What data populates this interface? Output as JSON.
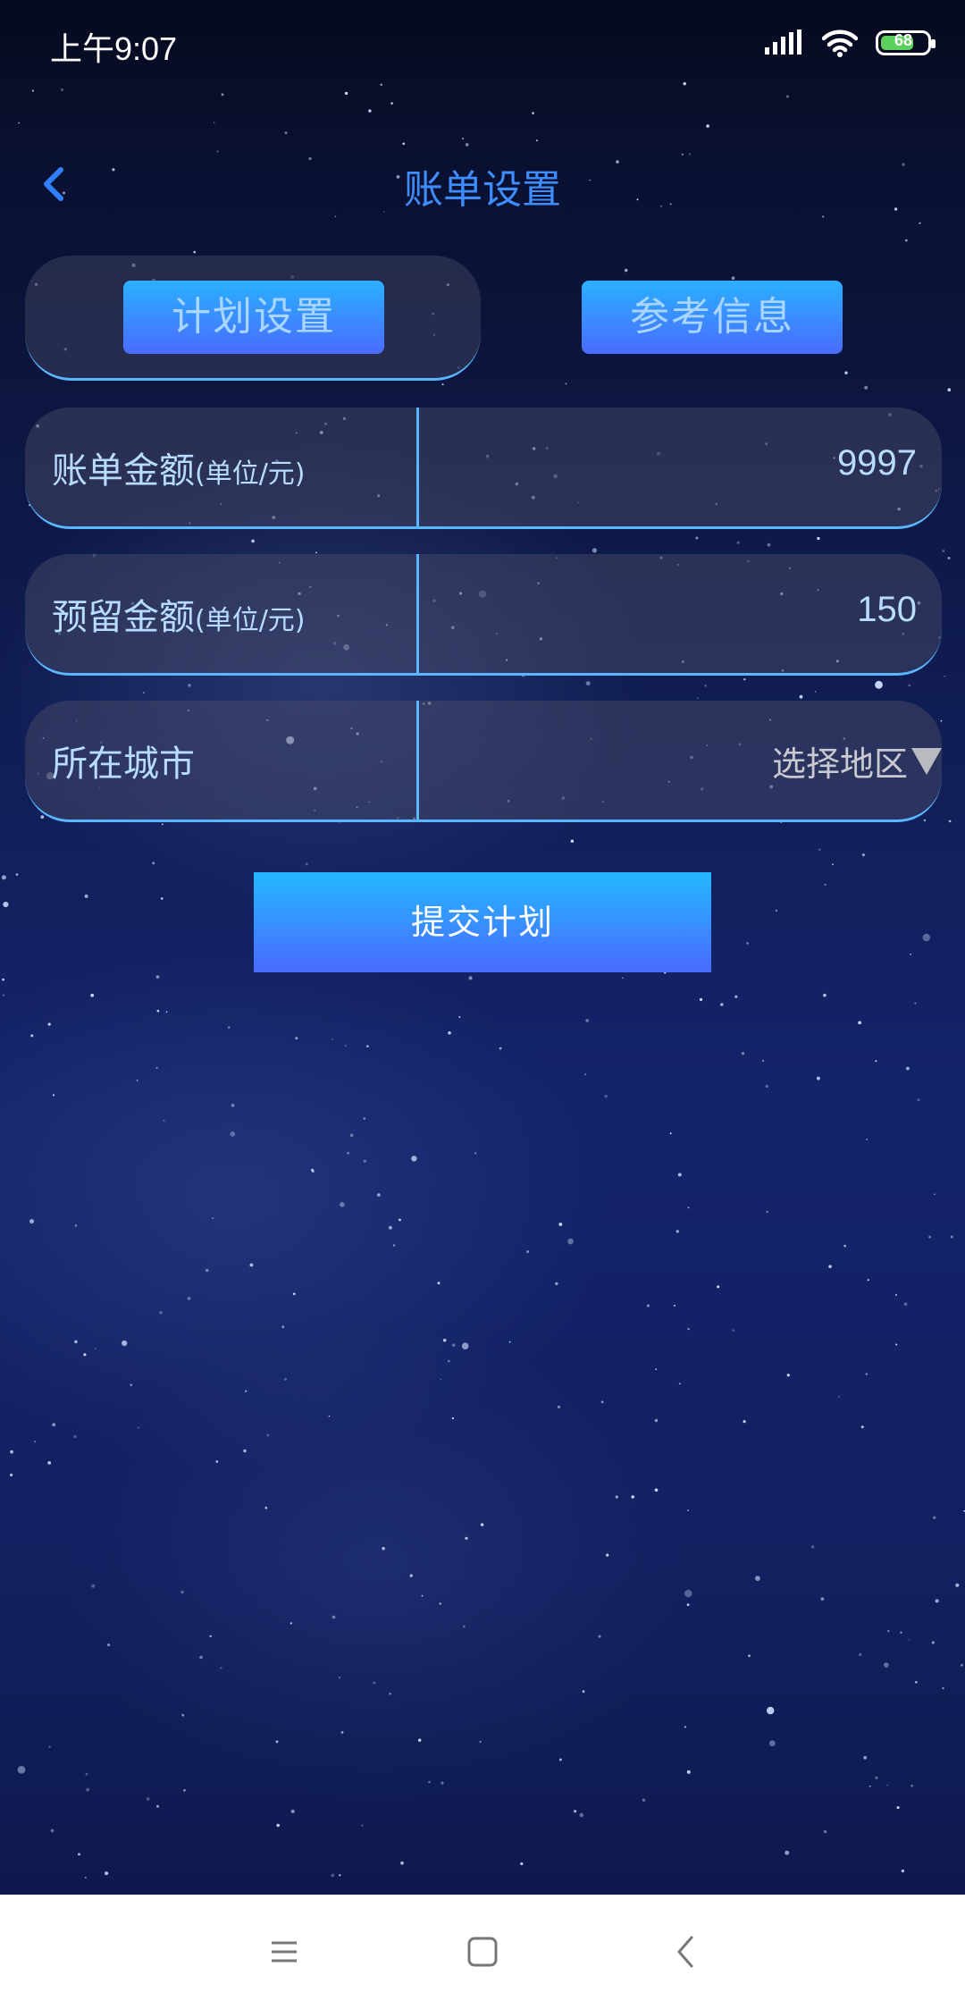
{
  "status_bar": {
    "time": "上午9:07",
    "battery_level": "68",
    "icons": [
      "signal-icon",
      "wifi-icon",
      "battery-icon"
    ]
  },
  "header": {
    "title": "账单设置",
    "back_icon": "chevron-left-icon"
  },
  "tabs": [
    {
      "label": "计划设置",
      "selected": true
    },
    {
      "label": "参考信息",
      "selected": false
    }
  ],
  "form": {
    "bill_amount": {
      "label": "账单金额",
      "unit": "(单位/元)",
      "value": "9997"
    },
    "reserved_amount": {
      "label": "预留金额",
      "unit": "(单位/元)",
      "value": "150"
    },
    "city": {
      "label": "所在城市",
      "placeholder": "选择地区",
      "icon": "triangle-down-icon"
    }
  },
  "submit_label": "提交计划",
  "nav_bar": {
    "icons": [
      "menu-icon",
      "home-icon",
      "back-icon"
    ]
  },
  "colors": {
    "accent_blue": "#3e8dff",
    "button_gradient_top": "#24b8ff",
    "button_gradient_bottom": "#4a6aff",
    "border_blue": "#5ab6ff",
    "label_text": "#b8dcff"
  }
}
